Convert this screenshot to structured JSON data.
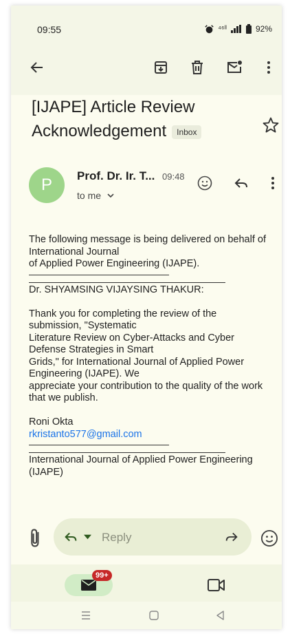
{
  "status_bar": {
    "time": "09:55",
    "network": "⁴⁶ˡˡ",
    "battery": "92%"
  },
  "email": {
    "subject": "[IJAPE] Article Review Acknowledgement",
    "label": "Inbox",
    "sender": "Prof. Dr. Ir. T...",
    "avatar_letter": "P",
    "sent_time": "09:48",
    "recipient": "to me",
    "body": {
      "intro_1": "The following message is being delivered on behalf of",
      "intro_2": "International Journal",
      "intro_3": "of Applied Power Engineering (IJAPE).",
      "greeting": "Dr. SHYAMSING VIJAYSING THAKUR:",
      "para_1": "Thank you for completing the review of the",
      "para_2": "submission, \"Systematic",
      "para_3": "Literature Review on Cyber-Attacks and Cyber",
      "para_4": "Defense Strategies in Smart",
      "para_5": "Grids,\" for International Journal of Applied Power",
      "para_6": "Engineering (IJAPE). We",
      "para_7": "appreciate your contribution to the quality of the work",
      "para_8": "that we publish.",
      "signature_name": "Roni Okta",
      "signature_email": "rkristanto577@gmail.com",
      "footer_1": "International Journal of Applied Power Engineering",
      "footer_2": "(IJAPE)"
    }
  },
  "reply_bar": {
    "reply_label": "Reply"
  },
  "bottom_nav": {
    "mail_badge": "99+"
  }
}
